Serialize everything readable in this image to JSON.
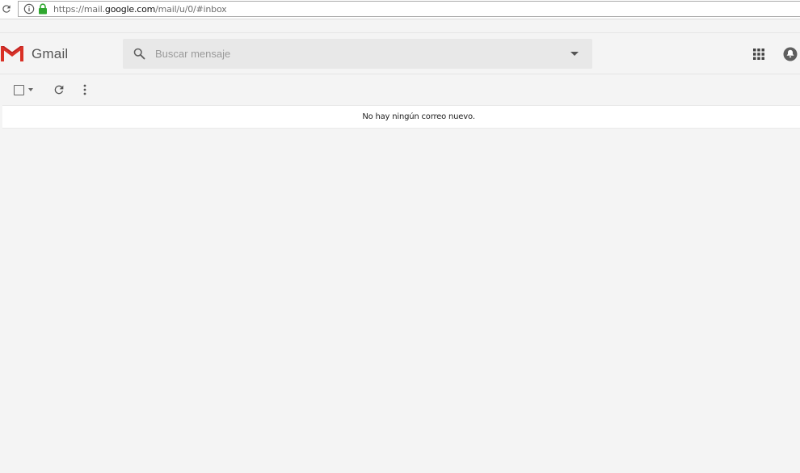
{
  "browser": {
    "url_prefix": "https://mail.",
    "url_host": "google.com",
    "url_path": "/mail/u/0/#inbox",
    "icons": {
      "reload": "reload-icon",
      "info": "info-icon",
      "lock": "lock-icon"
    },
    "lock_color": "#2fa72f"
  },
  "header": {
    "app_name": "Gmail",
    "logo_color": "#d93025",
    "search": {
      "placeholder": "Buscar mensaje",
      "value": ""
    },
    "icons": {
      "search": "search-icon",
      "search_options": "chevron-down-icon",
      "apps": "apps-grid-icon",
      "account": "account-icon"
    }
  },
  "toolbar": {
    "icons": {
      "select": "checkbox-icon",
      "refresh": "refresh-icon",
      "more": "more-vert-icon"
    }
  },
  "inbox": {
    "empty_message": "No hay ningún correo nuevo."
  }
}
